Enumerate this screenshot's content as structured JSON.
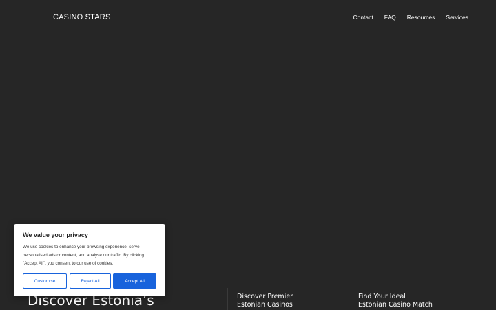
{
  "header": {
    "logo": "CASINO STARS",
    "nav": [
      "Contact",
      "FAQ",
      "Resources",
      "Services"
    ]
  },
  "hero": {
    "title": "Discover Estonia’s",
    "features": [
      {
        "line1": "Discover Premier",
        "line2": "Estonian Casinos"
      },
      {
        "line1": "Find Your Ideal",
        "line2": "Estonian Casino Match"
      }
    ]
  },
  "cookie": {
    "title": "We value your privacy",
    "text": "We use cookies to enhance your browsing experience, serve personalised ads or content, and analyse our traffic. By clicking \"Accept All\", you consent to our use of cookies.",
    "customise": "Customise",
    "reject": "Reject All",
    "accept": "Accept All"
  },
  "colors": {
    "background": "#262626",
    "accent": "#1863dc",
    "text": "#ffffff"
  }
}
